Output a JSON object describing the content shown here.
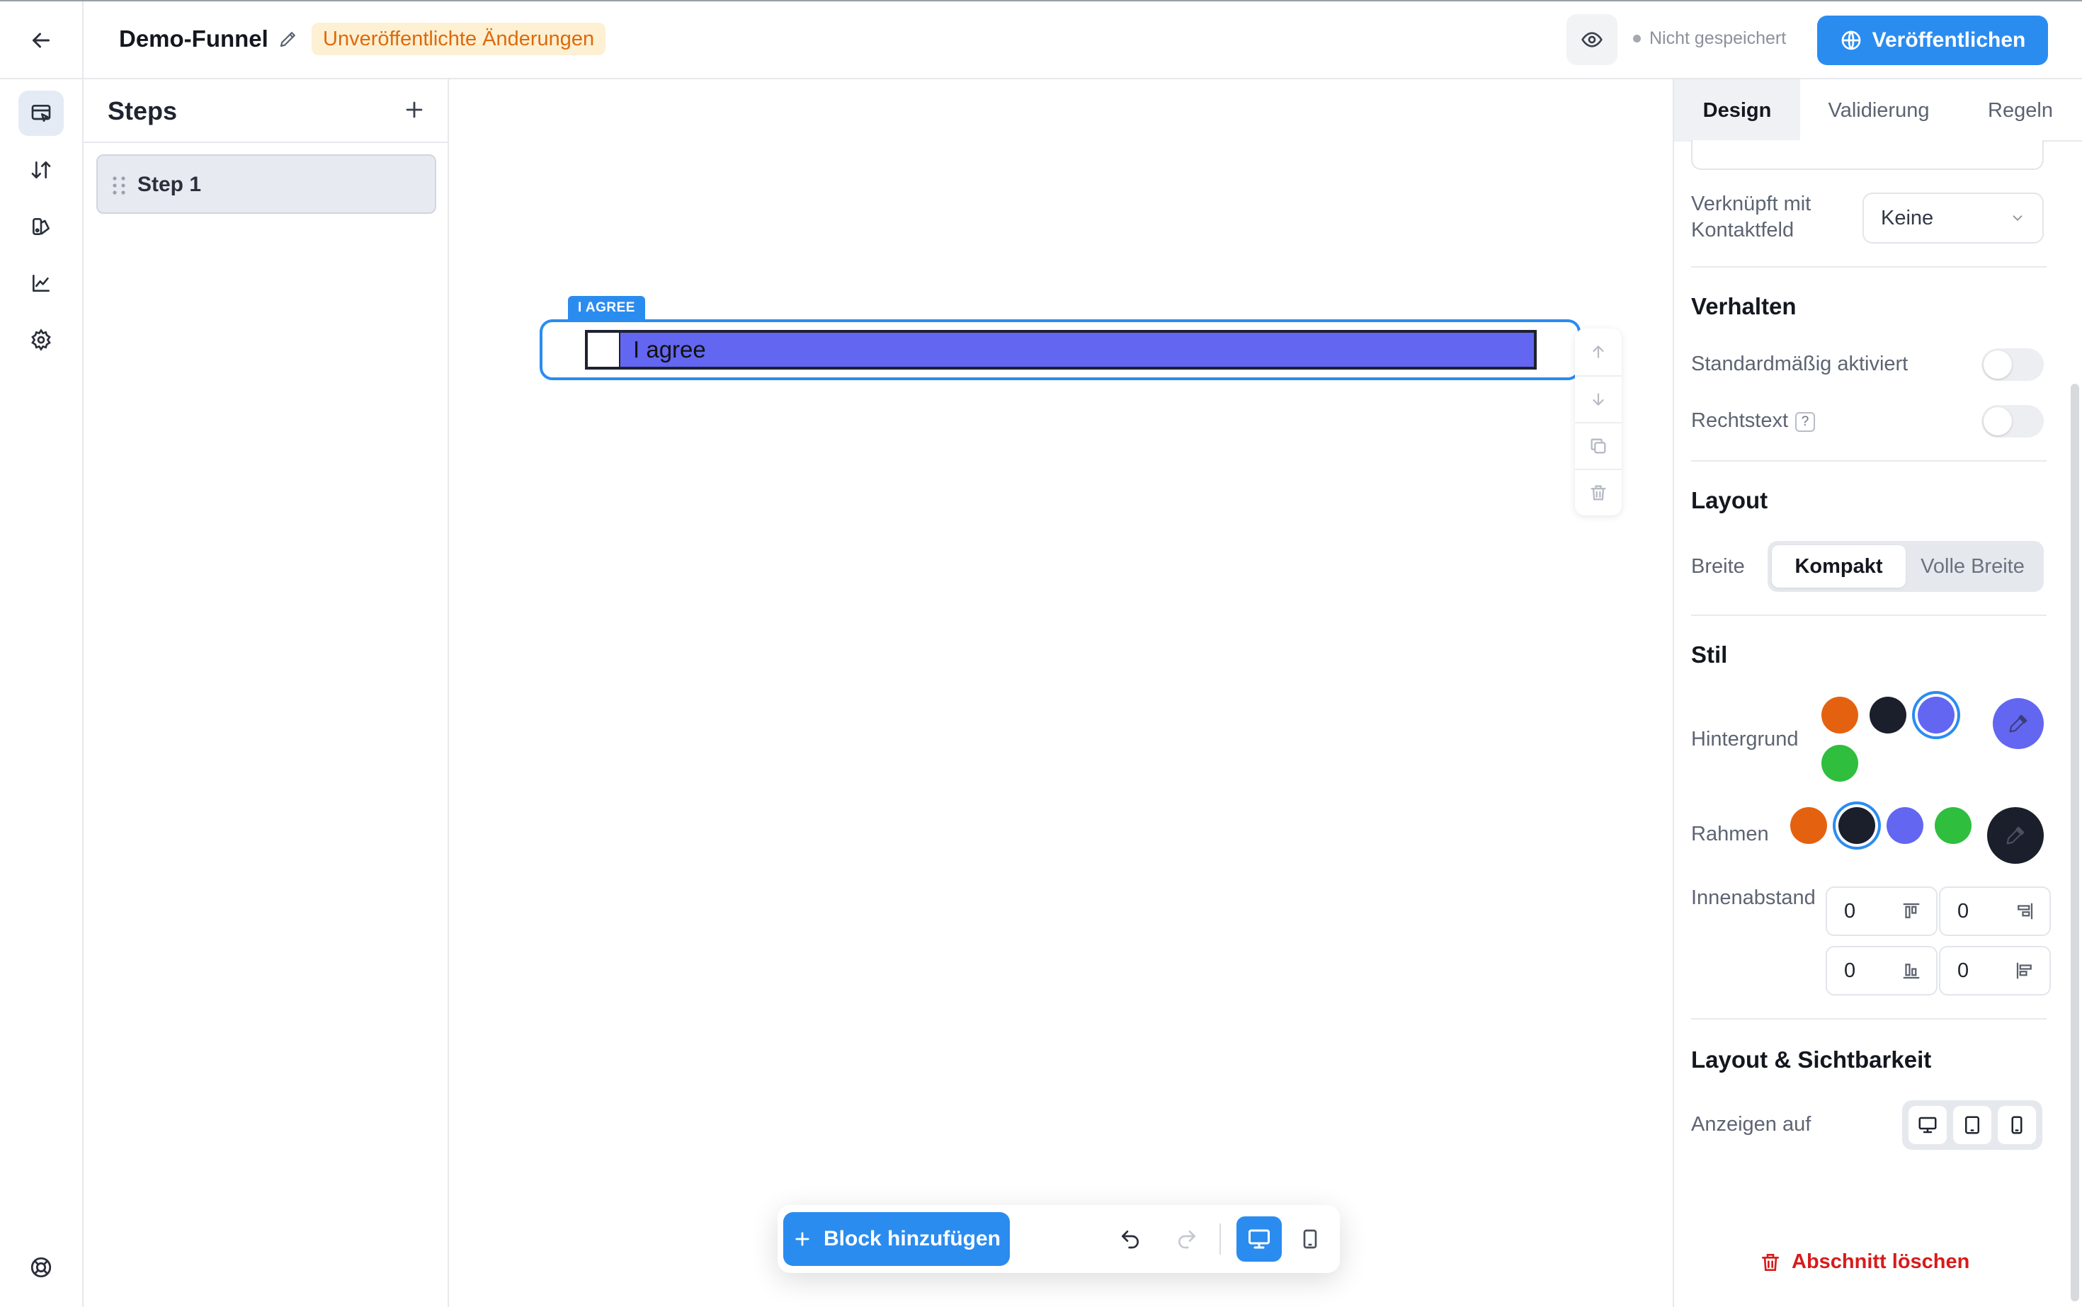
{
  "header": {
    "funnel_title": "Demo-Funnel",
    "unsaved_badge": "Unveröffentlichte Änderungen",
    "save_status": "Nicht gespeichert",
    "publish_label": "Veröffentlichen"
  },
  "rail": {
    "items": [
      "editor-icon",
      "sort-icon",
      "palette-icon",
      "chart-icon",
      "gear-icon"
    ],
    "bottom": "help-icon"
  },
  "steps": {
    "title": "Steps",
    "items": [
      {
        "label": "Step 1"
      }
    ]
  },
  "canvas": {
    "block_tag": "I AGREE",
    "checkbox_label": "I agree",
    "checkbox_bg": "#6366f1"
  },
  "bottom_bar": {
    "add_block_label": "Block hinzufügen"
  },
  "right_panel": {
    "tabs": [
      {
        "label": "Design",
        "active": true
      },
      {
        "label": "Validierung",
        "active": false
      },
      {
        "label": "Regeln",
        "active": false
      }
    ],
    "linked_field": {
      "label_line1": "Verknüpft mit",
      "label_line2": "Kontaktfeld",
      "value": "Keine"
    },
    "behavior": {
      "title": "Verhalten",
      "default_checked_label": "Standardmäßig aktiviert",
      "legal_text_label": "Rechtstext",
      "legal_help": "?"
    },
    "layout": {
      "title": "Layout",
      "width_label": "Breite",
      "options": [
        "Kompakt",
        "Volle Breite"
      ],
      "selected": "Kompakt"
    },
    "style": {
      "title": "Stil",
      "background_label": "Hintergrund",
      "border_label": "Rahmen",
      "padding_label": "Innenabstand",
      "colors": {
        "orange": "#e4620f",
        "navy": "#1b1e2b",
        "indigo": "#6366f1",
        "green": "#2fbe3d"
      },
      "background_selected": "#6366f1",
      "border_selected": "#1b1e2b",
      "padding": {
        "top": "0",
        "right": "0",
        "bottom": "0",
        "left": "0"
      }
    },
    "visibility": {
      "title": "Layout & Sichtbarkeit",
      "show_on_label": "Anzeigen auf"
    },
    "delete_label": "Abschnitt löschen"
  }
}
